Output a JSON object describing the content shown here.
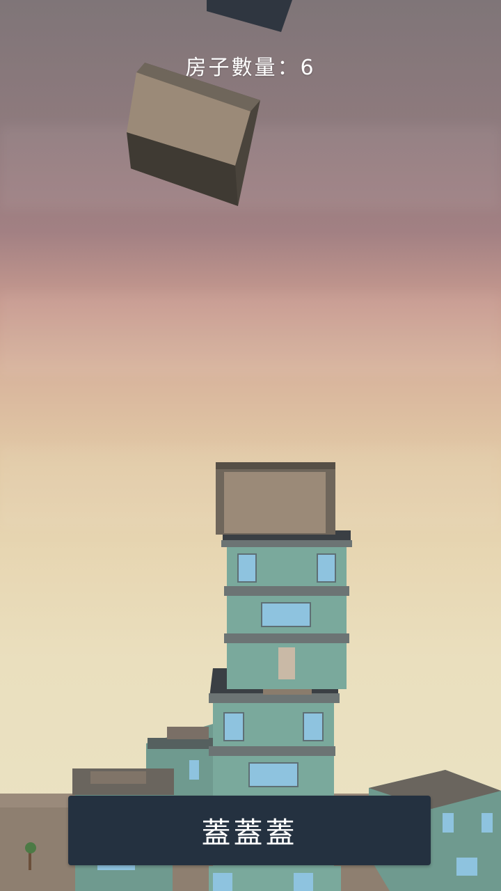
{
  "hud": {
    "house_count_label": "房子數量：6"
  },
  "build_button": {
    "label": "蓋蓋蓋"
  },
  "colors": {
    "floor_teal": "#7aa99c",
    "window_blue": "#8ec3df",
    "crate_brown": "#9b8a78",
    "button_bg": "#243140"
  }
}
